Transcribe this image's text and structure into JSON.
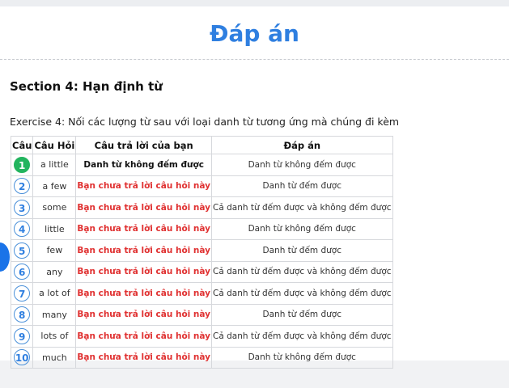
{
  "header": {
    "title": "Đáp án"
  },
  "section": {
    "title": "Section 4: Hạn định từ"
  },
  "exercise": {
    "instruction": "Exercise 4: Nối các lượng từ sau với loại danh từ tương ứng mà chúng đi kèm"
  },
  "table": {
    "columns": [
      "Câu",
      "Câu Hỏi",
      "Câu trả lời của bạn",
      "Đáp án"
    ],
    "rows": [
      {
        "num": "1",
        "question": "a little",
        "answer": "Danh từ không đếm được",
        "correct": "Danh từ không đếm được",
        "answered": true
      },
      {
        "num": "2",
        "question": "a few",
        "answer": "Bạn chưa trả lời câu hỏi này",
        "correct": "Danh từ đếm được",
        "answered": false
      },
      {
        "num": "3",
        "question": "some",
        "answer": "Bạn chưa trả lời câu hỏi này",
        "correct": "Cả danh từ đếm được và không đếm được",
        "answered": false
      },
      {
        "num": "4",
        "question": "little",
        "answer": "Bạn chưa trả lời câu hỏi này",
        "correct": "Danh từ không đếm được",
        "answered": false
      },
      {
        "num": "5",
        "question": "few",
        "answer": "Bạn chưa trả lời câu hỏi này",
        "correct": "Danh từ đếm được",
        "answered": false
      },
      {
        "num": "6",
        "question": "any",
        "answer": "Bạn chưa trả lời câu hỏi này",
        "correct": "Cả danh từ đếm được và không đếm được",
        "answered": false
      },
      {
        "num": "7",
        "question": "a lot of",
        "answer": "Bạn chưa trả lời câu hỏi này",
        "correct": "Cả danh từ đếm được và không đếm được",
        "answered": false
      },
      {
        "num": "8",
        "question": "many",
        "answer": "Bạn chưa trả lời câu hỏi này",
        "correct": "Danh từ đếm được",
        "answered": false
      },
      {
        "num": "9",
        "question": "lots of",
        "answer": "Bạn chưa trả lời câu hỏi này",
        "correct": "Cả danh từ đếm được và không đếm được",
        "answered": false
      },
      {
        "num": "10",
        "question": "much",
        "answer": "Bạn chưa trả lời câu hỏi này",
        "correct": "Danh từ không đếm được",
        "answered": false
      }
    ]
  },
  "colors": {
    "accent": "#2f7fe0",
    "answered_badge": "#22b45e",
    "unanswered_text": "#e03131"
  }
}
